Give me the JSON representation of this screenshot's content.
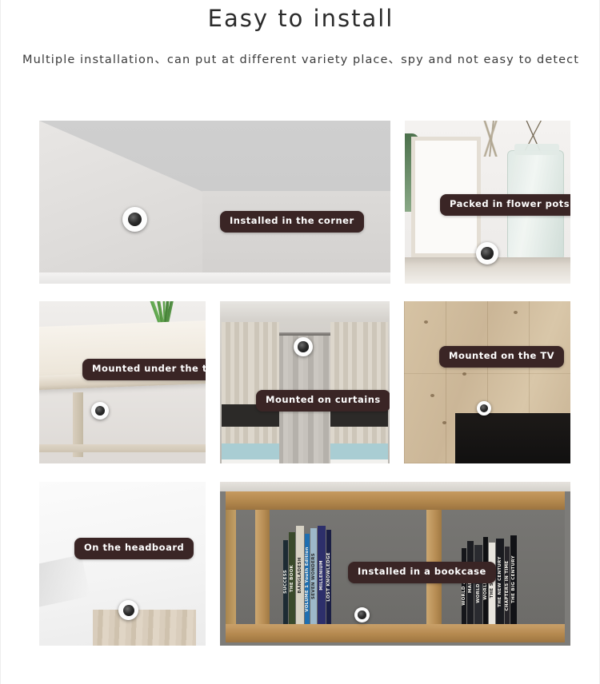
{
  "header": {
    "title": "Easy to install",
    "subtitle": "Multiple installation、can put at different variety place、spy and not easy to detect"
  },
  "theme": {
    "background": "#ffffff",
    "chip_background": "#3a2525",
    "chip_text": "#ffffff",
    "title_color": "#2b2b2b",
    "subtitle_color": "#3b3b3b"
  },
  "gallery": {
    "panels": [
      {
        "id": "corner",
        "caption": "Installed in the corner",
        "scene": "ceiling corner of a grey room with camera mounted at the wall junction"
      },
      {
        "id": "flowerpot",
        "caption": "Packed in flower pots",
        "scene": "shelf with picture frame, green leaf and glass jar of dried twigs"
      },
      {
        "id": "table",
        "caption": "Mounted under the table",
        "scene": "underside of a light wooden table with a potted plant"
      },
      {
        "id": "curtains",
        "caption": "Mounted on curtains",
        "scene": "striped curtains on a rod with sheer panel behind"
      },
      {
        "id": "tv",
        "caption": "Mounted on the TV",
        "scene": "wood plank wall above a black flat-screen television"
      },
      {
        "id": "headboard",
        "caption": "On the headboard",
        "scene": "white wall above a light wooden bed headboard"
      },
      {
        "id": "bookcase",
        "caption": "Installed in a bookcase",
        "scene": "wooden bookcase shelf filled with books"
      }
    ]
  },
  "book_spines_left": [
    "SUCCESS",
    "THE BOOK",
    "BANGLADESH",
    "VOLUME 1 Youth Edition",
    "SEVEN WONDERS",
    "MILLENIUM",
    "LOST KNOWLEDGE"
  ],
  "book_spines_right": [
    "WORLD ATLAS",
    "MARINE",
    "WORLD ATLAS",
    "WORLD ATLAS",
    "THE STORY",
    "THE NEW CENTURY",
    "CHAPTERS IN TIME",
    "THE BIG CENTURY"
  ]
}
